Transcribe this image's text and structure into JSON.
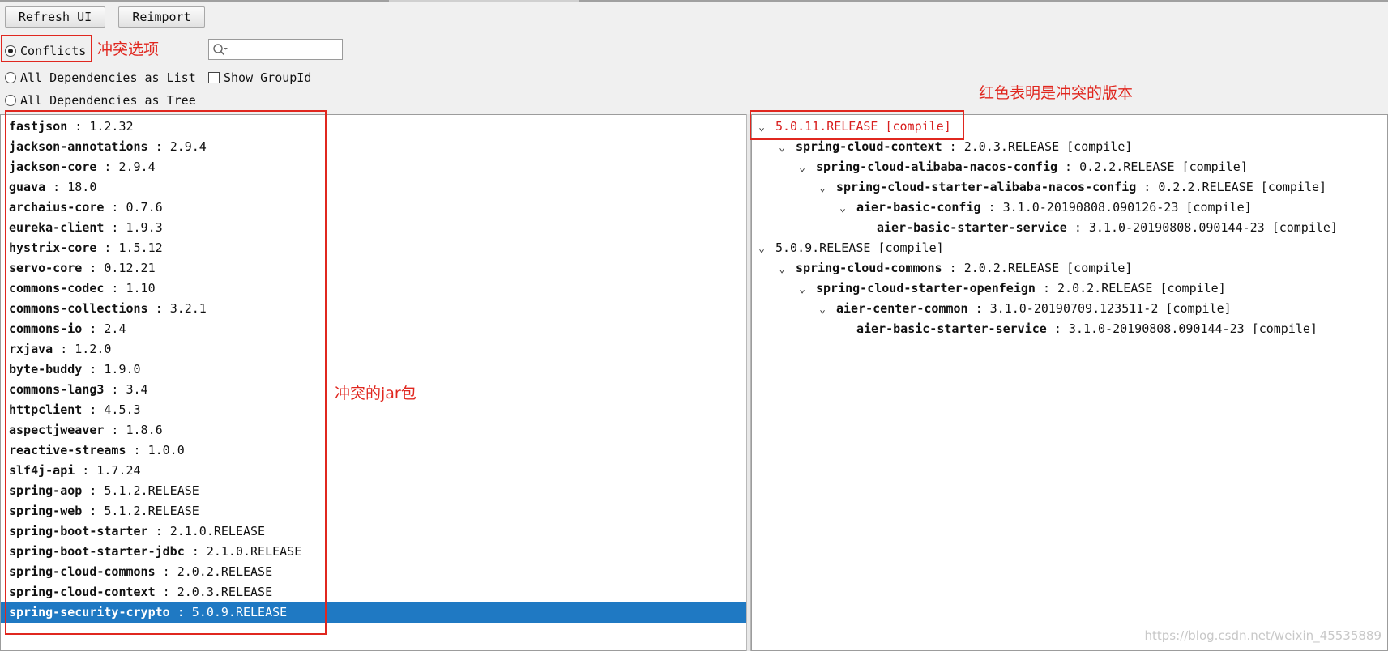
{
  "toolbar": {
    "refresh_label": "Refresh UI",
    "reimport_label": "Reimport"
  },
  "modes": {
    "conflicts": "Conflicts",
    "as_list": "All Dependencies as List",
    "as_tree": "All Dependencies as Tree",
    "show_group_id": "Show GroupId"
  },
  "search": {
    "placeholder": ""
  },
  "annotations": {
    "conflict_option": "冲突选项",
    "conflict_jars": "冲突的jar包",
    "red_means_conflict": "红色表明是冲突的版本"
  },
  "conflict_list": [
    {
      "name": "fastjson",
      "version": "1.2.32"
    },
    {
      "name": "jackson-annotations",
      "version": "2.9.4"
    },
    {
      "name": "jackson-core",
      "version": "2.9.4"
    },
    {
      "name": "guava",
      "version": "18.0"
    },
    {
      "name": "archaius-core",
      "version": "0.7.6"
    },
    {
      "name": "eureka-client",
      "version": "1.9.3"
    },
    {
      "name": "hystrix-core",
      "version": "1.5.12"
    },
    {
      "name": "servo-core",
      "version": "0.12.21"
    },
    {
      "name": "commons-codec",
      "version": "1.10"
    },
    {
      "name": "commons-collections",
      "version": "3.2.1"
    },
    {
      "name": "commons-io",
      "version": "2.4"
    },
    {
      "name": "rxjava",
      "version": "1.2.0"
    },
    {
      "name": "byte-buddy",
      "version": "1.9.0"
    },
    {
      "name": "commons-lang3",
      "version": "3.4"
    },
    {
      "name": "httpclient",
      "version": "4.5.3"
    },
    {
      "name": "aspectjweaver",
      "version": "1.8.6"
    },
    {
      "name": "reactive-streams",
      "version": "1.0.0"
    },
    {
      "name": "slf4j-api",
      "version": "1.7.24"
    },
    {
      "name": "spring-aop",
      "version": "5.1.2.RELEASE"
    },
    {
      "name": "spring-web",
      "version": "5.1.2.RELEASE"
    },
    {
      "name": "spring-boot-starter",
      "version": "2.1.0.RELEASE"
    },
    {
      "name": "spring-boot-starter-jdbc",
      "version": "2.1.0.RELEASE"
    },
    {
      "name": "spring-cloud-commons",
      "version": "2.0.2.RELEASE"
    },
    {
      "name": "spring-cloud-context",
      "version": "2.0.3.RELEASE"
    },
    {
      "name": "spring-security-crypto",
      "version": "5.0.9.RELEASE",
      "selected": true
    }
  ],
  "tree": [
    {
      "level": 0,
      "name": "",
      "version": "5.0.11.RELEASE",
      "scope": "[compile]",
      "expanded": true,
      "conflict": true
    },
    {
      "level": 1,
      "name": "spring-cloud-context",
      "version": "2.0.3.RELEASE",
      "scope": "[compile]",
      "expanded": true
    },
    {
      "level": 2,
      "name": "spring-cloud-alibaba-nacos-config",
      "version": "0.2.2.RELEASE",
      "scope": "[compile]",
      "expanded": true
    },
    {
      "level": 3,
      "name": "spring-cloud-starter-alibaba-nacos-config",
      "version": "0.2.2.RELEASE",
      "scope": "[compile]",
      "expanded": true
    },
    {
      "level": 4,
      "name": "aier-basic-config",
      "version": "3.1.0-20190808.090126-23",
      "scope": "[compile]",
      "expanded": true
    },
    {
      "level": 5,
      "name": "aier-basic-starter-service",
      "version": "3.1.0-20190808.090144-23",
      "scope": "[compile]",
      "leaf": true
    },
    {
      "level": 0,
      "name": "",
      "version": "5.0.9.RELEASE",
      "scope": "[compile]",
      "expanded": true
    },
    {
      "level": 1,
      "name": "spring-cloud-commons",
      "version": "2.0.2.RELEASE",
      "scope": "[compile]",
      "expanded": true
    },
    {
      "level": 2,
      "name": "spring-cloud-starter-openfeign",
      "version": "2.0.2.RELEASE",
      "scope": "[compile]",
      "expanded": true
    },
    {
      "level": 3,
      "name": "aier-center-common",
      "version": "3.1.0-20190709.123511-2",
      "scope": "[compile]",
      "expanded": true
    },
    {
      "level": 4,
      "name": "aier-basic-starter-service",
      "version": "3.1.0-20190808.090144-23",
      "scope": "[compile]",
      "leaf": true
    }
  ],
  "watermark": "https://blog.csdn.net/weixin_45535889",
  "colors": {
    "selection": "#1f79c3",
    "conflict": "#d81e1e",
    "annotation": "#e0271f"
  }
}
